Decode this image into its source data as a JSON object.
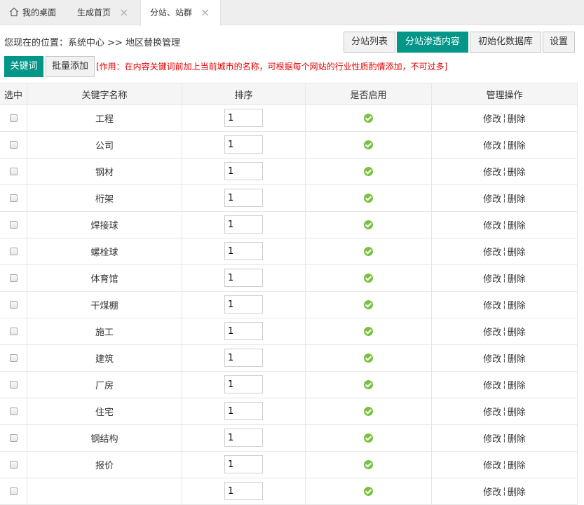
{
  "tabs": [
    {
      "label": "我的桌面",
      "icon": "home-icon"
    },
    {
      "label": "生成首页",
      "closable": true
    },
    {
      "label": "分站、站群",
      "closable": true,
      "active": true
    }
  ],
  "breadcrumb": "您现在的位置：系统中心 >> 地区替换管理",
  "toolbar": {
    "list_label": "分站列表",
    "infiltrate_label": "分站渗透内容",
    "init_db_label": "初始化数据库",
    "settings_label": "设置"
  },
  "subbar": {
    "keyword_label": "关键词",
    "batch_add_label": "批量添加",
    "note": "[作用：在内容关键词前加上当前城市的名称，可根据每个网站的行业性质酌情添加，不可过多]"
  },
  "table": {
    "headers": [
      "选中",
      "关键字名称",
      "排序",
      "是否启用",
      "管理操作"
    ],
    "edit_label": "修改",
    "delete_label": "删除",
    "sep": "¦",
    "rows": [
      {
        "name": "工程",
        "order": "1"
      },
      {
        "name": "公司",
        "order": "1"
      },
      {
        "name": "钢材",
        "order": "1"
      },
      {
        "name": "桁架",
        "order": "1"
      },
      {
        "name": "焊接球",
        "order": "1"
      },
      {
        "name": "螺栓球",
        "order": "1"
      },
      {
        "name": "体育馆",
        "order": "1"
      },
      {
        "name": "干煤棚",
        "order": "1"
      },
      {
        "name": "施工",
        "order": "1"
      },
      {
        "name": "建筑",
        "order": "1"
      },
      {
        "name": "厂房",
        "order": "1"
      },
      {
        "name": "住宅",
        "order": "1"
      },
      {
        "name": "钢结构",
        "order": "1"
      },
      {
        "name": "报价",
        "order": "1"
      },
      {
        "name": "",
        "order": "1"
      }
    ]
  },
  "colors": {
    "accent": "#009688",
    "enabled": "#7ac143",
    "note": "#e60000"
  }
}
